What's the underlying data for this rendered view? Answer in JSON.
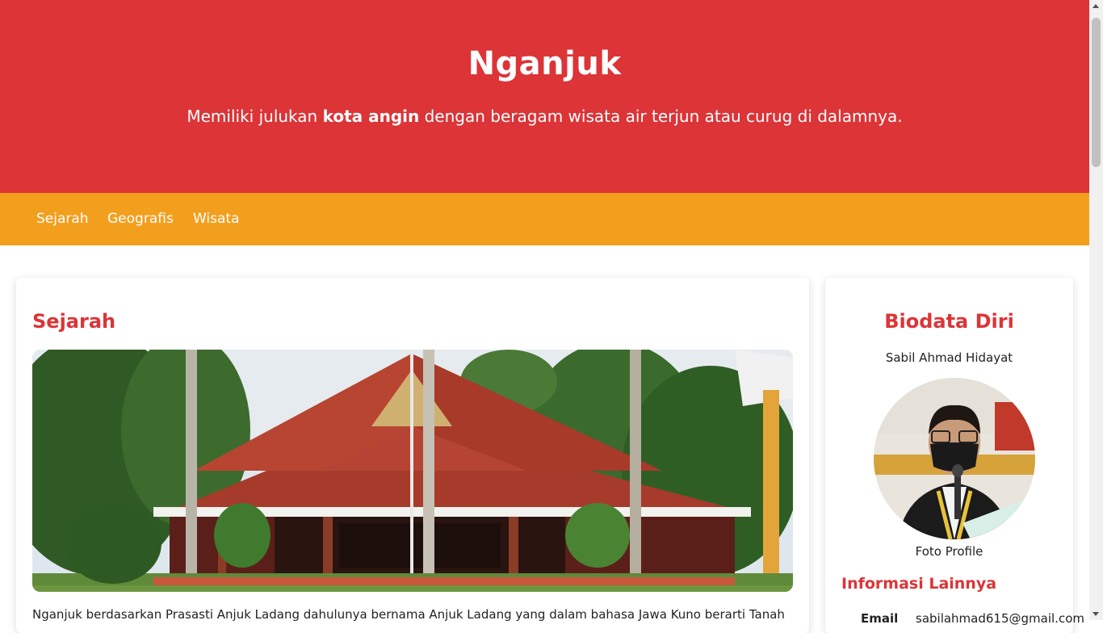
{
  "header": {
    "title": "Nganjuk",
    "tagline_prefix": "Memiliki julukan ",
    "tagline_bold": "kota angin",
    "tagline_suffix": " dengan beragam wisata air terjun atau curug di dalamnya."
  },
  "nav": {
    "items": [
      {
        "label": "Sejarah"
      },
      {
        "label": "Geografis"
      },
      {
        "label": "Wisata"
      }
    ]
  },
  "main": {
    "section_title": "Sejarah",
    "paragraph": "Nganjuk berdasarkan Prasasti Anjuk Ladang dahulunya bernama Anjuk Ladang yang dalam bahasa Jawa Kuno berarti Tanah"
  },
  "sidebar": {
    "title": "Biodata Diri",
    "name": "Sabil Ahmad Hidayat",
    "photo_caption": "Foto Profile",
    "info_title": "Informasi Lainnya",
    "email_label": "Email",
    "email_value": "sabilahmad615@gmail.com"
  },
  "colors": {
    "header_bg": "#dc3437",
    "nav_bg": "#f39f1e",
    "accent_text": "#dc3437"
  }
}
